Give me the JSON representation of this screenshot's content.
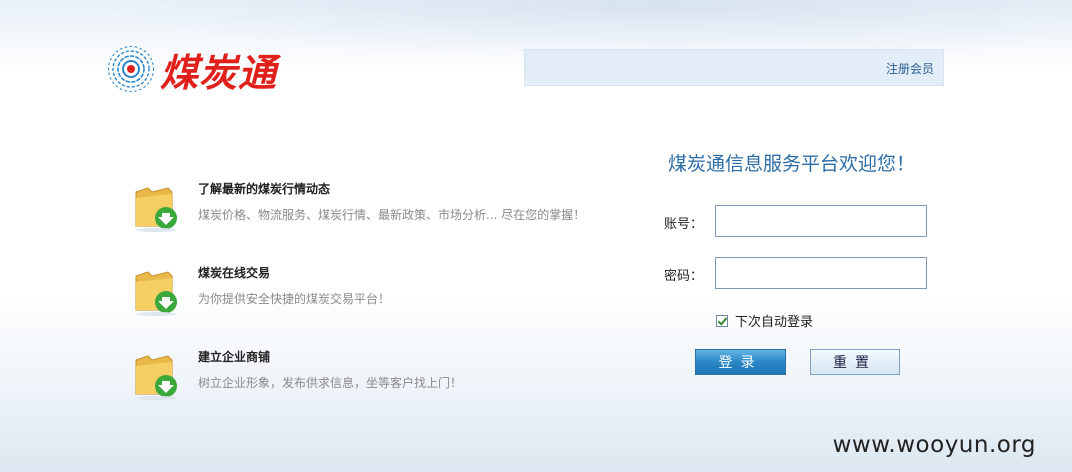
{
  "logo": {
    "text": "煤炭通",
    "icon": "sunburst-logo-icon"
  },
  "header": {
    "register_link": "注册会员"
  },
  "features": [
    {
      "icon": "folder-download-icon",
      "title": "了解最新的煤炭行情动态",
      "desc": "煤炭价格、物流服务、煤炭行情、最新政策、市场分析... 尽在您的掌握！"
    },
    {
      "icon": "folder-download-icon",
      "title": "煤炭在线交易",
      "desc": "为你提供安全快捷的煤炭交易平台！"
    },
    {
      "icon": "folder-download-icon",
      "title": "建立企业商铺",
      "desc": "树立企业形象，发布供求信息，坐等客户找上门！"
    }
  ],
  "login": {
    "welcome": "煤炭通信息服务平台欢迎您！",
    "account_label": "账号：",
    "account_value": "",
    "password_label": "密码：",
    "password_value": "",
    "remember_label": "下次自动登录",
    "remember_checked": true,
    "login_button": "登录",
    "reset_button": "重置"
  },
  "watermark": "www.wooyun.org",
  "colors": {
    "logo_red": "#e0201a",
    "link_blue": "#2b5f94",
    "welcome_blue": "#2c6ca6"
  }
}
